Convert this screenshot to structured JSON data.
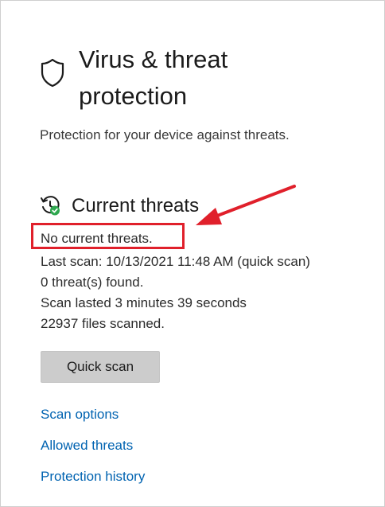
{
  "header": {
    "title": "Virus & threat protection",
    "subtitle": "Protection for your device against threats."
  },
  "current_threats": {
    "heading": "Current threats",
    "status": "No current threats.",
    "last_scan": "Last scan: 10/13/2021 11:48 AM (quick scan)",
    "threats_found": "0 threat(s) found.",
    "scan_duration": "Scan lasted 3 minutes 39 seconds",
    "files_scanned": "22937 files scanned.",
    "quick_scan_label": "Quick scan"
  },
  "links": {
    "scan_options": "Scan options",
    "allowed_threats": "Allowed threats",
    "protection_history": "Protection history"
  },
  "colors": {
    "accent_link": "#0063b1",
    "annotation_red": "#e0202b",
    "check_green": "#2fa84f"
  },
  "icons": {
    "title_icon": "shield-icon",
    "section_icon": "threat-history-check-icon",
    "annotation": "red-arrow"
  }
}
